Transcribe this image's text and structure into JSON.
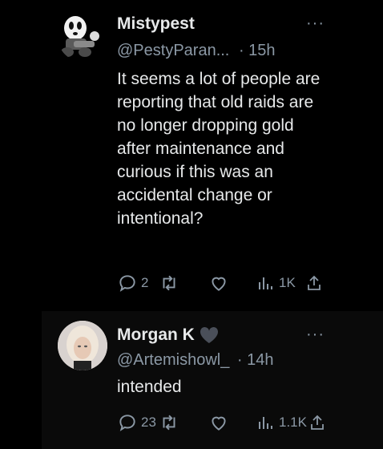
{
  "tweets": [
    {
      "name": "Mistypest",
      "handle": "@PestyParan...",
      "time": "· 15h",
      "more": "···",
      "text": "It seems a lot of people are reporting that old raids are no longer dropping gold after maintenance and curious if this was an accidental change or intentional?",
      "replies": "2",
      "retweets": "",
      "likes": "",
      "views": "1K",
      "verified_heart": false
    },
    {
      "name": "Morgan K",
      "handle": "@Artemishowl_",
      "time": "· 14h",
      "more": "···",
      "text": "intended",
      "replies": "23",
      "retweets": "",
      "likes": "",
      "views": "1.1K",
      "verified_heart": true
    }
  ],
  "colors": {
    "background": "#000000",
    "text": "#e7e9ea",
    "muted": "#8b98a5",
    "line": "#333639"
  },
  "icons": [
    "reply-icon",
    "retweet-icon",
    "like-icon",
    "views-icon",
    "share-icon",
    "more-icon",
    "heart-badge-icon"
  ]
}
